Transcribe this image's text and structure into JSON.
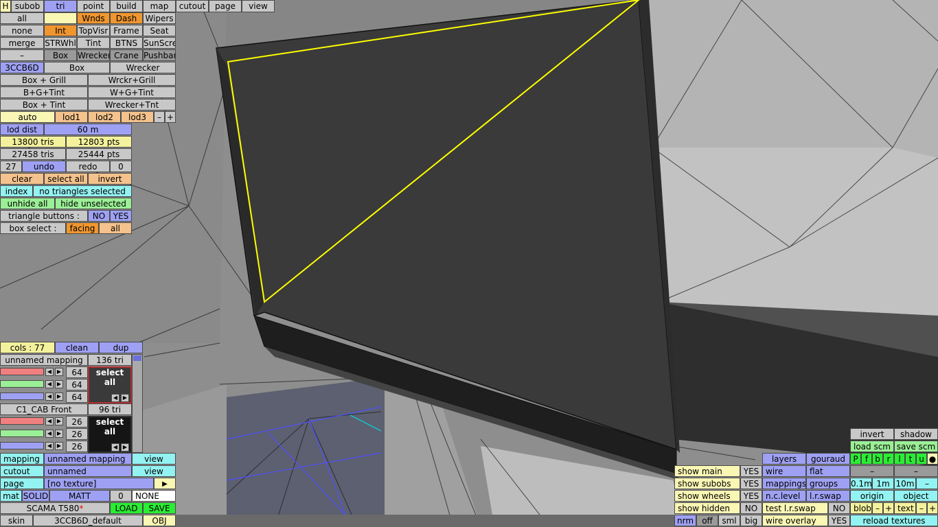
{
  "toolbar_top": [
    "H",
    "subob",
    "tri",
    "point",
    "build",
    "map",
    "cutout",
    "page",
    "view"
  ],
  "rows": {
    "r1": [
      "all",
      "",
      "Wnds",
      "Dash",
      "Wipers"
    ],
    "r2": [
      "none",
      "Int",
      "TopVisr",
      "Frame",
      "Seat"
    ],
    "r3": [
      "merge",
      "STRWhl",
      "Tint",
      "BTNS",
      "SunScre"
    ],
    "r4": [
      "–",
      "Box",
      "Wrecker",
      "Crane",
      "Pushbar"
    ],
    "r5": [
      "3CCB6D",
      "Box",
      "Wrecker"
    ],
    "r6": [
      "Box + Grill",
      "Wrckr+Grill"
    ],
    "r7": [
      "B+G+Tint",
      "W+G+Tint"
    ],
    "r8": [
      "Box + Tint",
      "Wrecker+Tnt"
    ],
    "lod": [
      "auto",
      "lod1",
      "lod2",
      "lod3",
      "–",
      "+"
    ]
  },
  "stats": {
    "lod_dist_label": "lod dist",
    "lod_dist": "60 m",
    "tris1": "13800 tris",
    "pts1": "12803 pts",
    "tris2": "27458 tris",
    "pts2": "25444 pts",
    "undo_count": "27",
    "undo": "undo",
    "redo": "redo",
    "redo_count": "0",
    "clear": "clear",
    "select_all": "select all",
    "invert": "invert",
    "index": "index",
    "selection_status": "no triangles selected",
    "unhide_all": "unhide all",
    "hide_unselected": "hide unselected",
    "triangle_buttons": "triangle buttons :",
    "no": "NO",
    "yes": "YES",
    "box_select": "box select :",
    "facing": "facing",
    "all": "all"
  },
  "materials": {
    "cols": "cols : 77",
    "clean": "clean",
    "dup": "dup",
    "m1_name": "unnamed mapping",
    "m1_tri": "136 tri",
    "m1_vals": [
      "64",
      "64",
      "64"
    ],
    "m1_swatch": "select all",
    "m2_name": "C1_CAB Front",
    "m2_tri": "96 tri",
    "m2_vals": [
      "26",
      "26",
      "26"
    ],
    "m2_swatch": "select all"
  },
  "bottom_left": {
    "mapping_label": "mapping",
    "mapping_value": "unnamed mapping",
    "mapping_view": "view",
    "cutout_label": "cutout",
    "cutout_value": "unnamed",
    "cutout_view": "view",
    "page_label": "page",
    "page_value": "[no texture]",
    "page_arrow": "▶",
    "mat": "mat",
    "solid": "SOLID",
    "matt": "MATT",
    "mat_num": "0",
    "mat_none": "NONE",
    "file": "SCAMA T580",
    "file_mark": "*",
    "load": "LOAD",
    "save": "SAVE",
    "skin": "skin",
    "skin_value": "3CCB6D_default",
    "obj": "OBJ"
  },
  "bottom_right": {
    "invert": "invert",
    "shadow": "shadow",
    "load_scm": "load scm",
    "save_scm": "save scm",
    "layers": "layers",
    "gouraud": "gouraud",
    "view_letters": [
      "P",
      "f",
      "b",
      "r",
      "l",
      "t",
      "u",
      "●"
    ],
    "show_main": "show main",
    "show_main_v": "YES",
    "wire": "wire",
    "flat": "flat",
    "dash1": "–",
    "dash2": "–",
    "show_subobs": "show subobs",
    "show_subobs_v": "YES",
    "mappings": "mappings",
    "groups": "groups",
    "grid": [
      "0.1m",
      "1m",
      "10m",
      "–"
    ],
    "show_wheels": "show wheels",
    "show_wheels_v": "YES",
    "nclevel": "n.c.level",
    "lrswap": "l.r.swap",
    "origin": "origin",
    "object": "object",
    "show_hidden": "show hidden",
    "show_hidden_v": "NO",
    "test_lr": "test l.r.swap",
    "test_lr_v": "NO",
    "blob": "blob",
    "text": "text",
    "pm": [
      "–",
      "+",
      "–",
      "+"
    ],
    "size": [
      "nrm",
      "off",
      "sml",
      "big"
    ],
    "wire_overlay": "wire overlay",
    "wire_overlay_v": "YES",
    "reload": "reload textures"
  },
  "colors": {
    "selection_edge": "#ffff00",
    "mesh_dark": "#3c3c3c",
    "background": "#8c8c8c"
  }
}
